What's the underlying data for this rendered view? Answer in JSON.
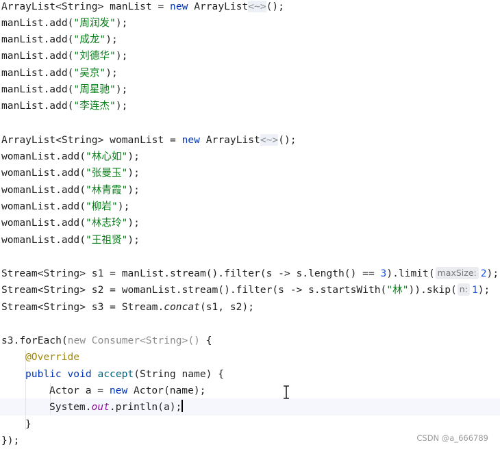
{
  "decl_arraylist": "ArrayList<String>",
  "man_list_var": "manList",
  "woman_list_var": "womanList",
  "kw_new": "new",
  "arraylist_ctor": "ArrayList",
  "diamond_fold": "<~>",
  "ctor_end": "();",
  "add_call": ".add(",
  "call_end": ");",
  "equals": " = ",
  "man_names": [
    "\"周润发\"",
    "\"成龙\"",
    "\"刘德华\"",
    "\"吴京\"",
    "\"周星驰\"",
    "\"李连杰\""
  ],
  "woman_names": [
    "\"林心如\"",
    "\"张曼玉\"",
    "\"林青霞\"",
    "\"柳岩\"",
    "\"林志玲\"",
    "\"王祖贤\""
  ],
  "stream_lines": {
    "s1_prefix": "Stream<String> s1 = manList.stream().filter(s -> s.length() == ",
    "s1_num": "3",
    "s1_mid": ").limit(",
    "s1_hint": "maxSize:",
    "s1_arg": "2",
    "s1_end": ");",
    "s2_prefix": "Stream<String> s2 = womanList.stream().filter(s -> s.startsWith(",
    "s2_str": "\"林\"",
    "s2_mid": ")).skip(",
    "s2_hint": "n:",
    "s2_arg": "1",
    "s2_end": ");",
    "s3_prefix": "Stream<String> s3 = Stream.",
    "s3_method": "concat",
    "s3_end": "(s1, s2);"
  },
  "foreach_block": {
    "receiver": "s3.forEach(",
    "anon_new": "new",
    "anon_type": " Consumer<String>() ",
    "open_brace": "{",
    "annotation": "@Override",
    "kw_public": "public",
    "kw_void": "void",
    "method_name": "accept",
    "params": "(String name) {",
    "actor_type": "Actor a = ",
    "actor_new": "new",
    "actor_ctor": " Actor(name);",
    "sys": "System.",
    "out_field": "out",
    "println": ".println(a);",
    "inner_close": "}",
    "outer_close": "});"
  },
  "watermark": "CSDN @a_666789",
  "colors": {
    "keyword": "#0033b3",
    "string": "#067d17",
    "number": "#1750eb",
    "annotation": "#9e880d",
    "static_field": "#871094",
    "method_declaration": "#00627a",
    "current_line": "#f5f7fc"
  }
}
